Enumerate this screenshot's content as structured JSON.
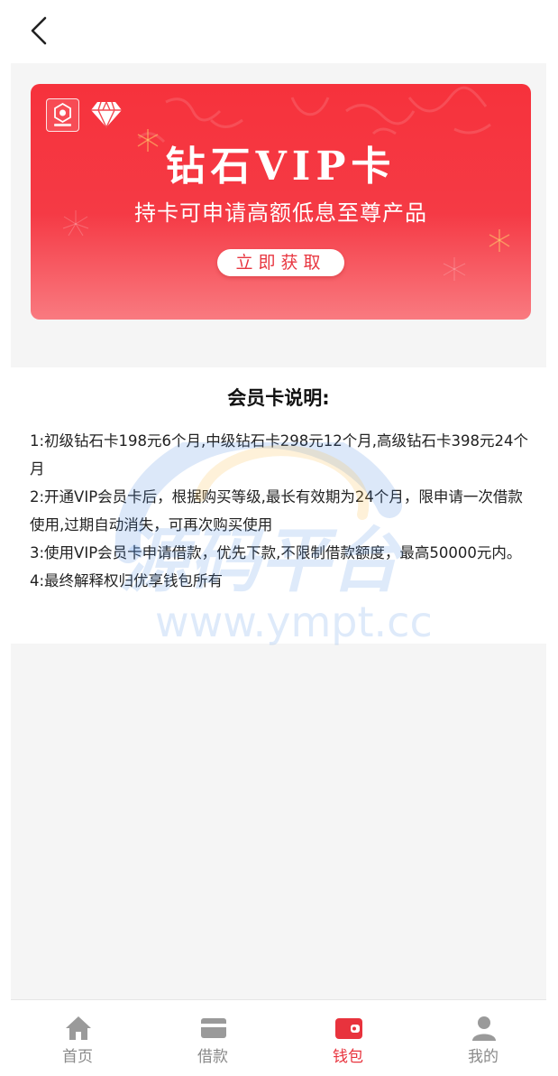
{
  "header": {
    "back_icon": "chevron-left-icon"
  },
  "banner": {
    "logo_icon": "brand-logo-icon",
    "diamond_icon": "diamond-icon",
    "title": "钻石VIP卡",
    "subtitle": "持卡可申请高额低息至尊产品",
    "button_label": "立即获取",
    "colors": {
      "gradient_top": "#f6323c",
      "gradient_bottom": "#f97a80",
      "button_text": "#e83640"
    }
  },
  "description": {
    "title": "会员卡说明:",
    "items": [
      "1:初级钻石卡198元6个月,中级钻石卡298元12个月,高级钻石卡398元24个月",
      "2:开通VIP会员卡后，根据购买等级,最长有效期为24个月，限申请一次借款使用,过期自动消失，可再次购买使用",
      "3:使用VIP会员卡申请借款，优先下款,不限制借款额度，最高50000元内。",
      "4:最终解释权归优享钱包所有"
    ]
  },
  "watermark": {
    "text": "源码平台",
    "url": "www.ympt.cc"
  },
  "tabbar": {
    "active_color": "#e8333d",
    "inactive_color": "#8a8a8a",
    "items": [
      {
        "label": "首页",
        "icon": "home-icon",
        "active": false
      },
      {
        "label": "借款",
        "icon": "card-icon",
        "active": false
      },
      {
        "label": "钱包",
        "icon": "wallet-icon",
        "active": true
      },
      {
        "label": "我的",
        "icon": "user-icon",
        "active": false
      }
    ]
  }
}
